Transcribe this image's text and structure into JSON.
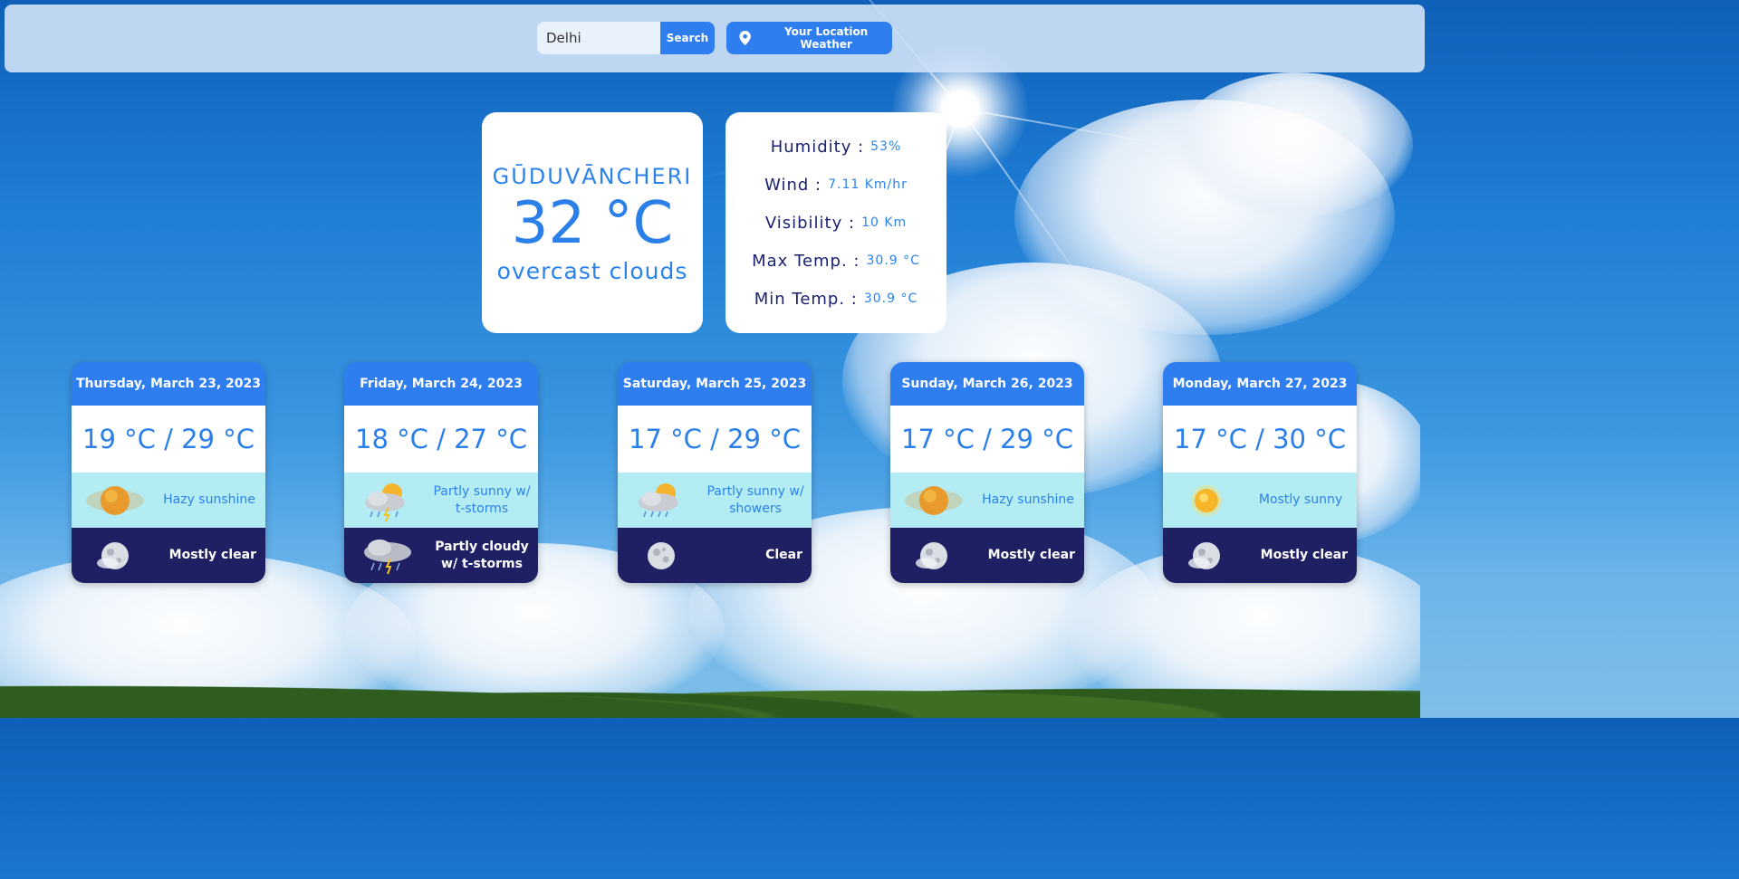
{
  "search": {
    "value": "Delhi",
    "button_label": "Search"
  },
  "location_button": {
    "label": "Your Location Weather",
    "icon": "map-pin-icon"
  },
  "current": {
    "city": "GŪDUVĀNCHERI",
    "temperature": "32 °C",
    "description": "overcast clouds"
  },
  "details": [
    {
      "label": "Humidity :",
      "value": "53%"
    },
    {
      "label": "Wind :",
      "value": "7.11 Km/hr"
    },
    {
      "label": "Visibility :",
      "value": "10 Km"
    },
    {
      "label": "Max Temp. :",
      "value": "30.9 °C"
    },
    {
      "label": "Min Temp. :",
      "value": "30.9 °C"
    }
  ],
  "forecast": [
    {
      "date": "Thursday, March 23, 2023",
      "temp": "19 °C / 29 °C",
      "day_text": "Hazy sunshine",
      "day_icon": "hazy-sun-icon",
      "night_text": "Mostly clear",
      "night_icon": "moon-cloud-icon"
    },
    {
      "date": "Friday, March 24, 2023",
      "temp": "18 °C / 27 °C",
      "day_text": "Partly sunny w/ t-storms",
      "day_icon": "sun-storm-icon",
      "night_text": "Partly cloudy w/ t-storms",
      "night_icon": "storm-cloud-icon"
    },
    {
      "date": "Saturday, March 25, 2023",
      "temp": "17 °C / 29 °C",
      "day_text": "Partly sunny w/ showers",
      "day_icon": "sun-showers-icon",
      "night_text": "Clear",
      "night_icon": "moon-icon"
    },
    {
      "date": "Sunday, March 26, 2023",
      "temp": "17 °C / 29 °C",
      "day_text": "Hazy sunshine",
      "day_icon": "hazy-sun-icon",
      "night_text": "Mostly clear",
      "night_icon": "moon-cloud-icon"
    },
    {
      "date": "Monday, March 27, 2023",
      "temp": "17 °C / 30 °C",
      "day_text": "Mostly sunny",
      "day_icon": "sun-icon",
      "night_text": "Mostly clear",
      "night_icon": "moon-cloud-icon"
    }
  ]
}
